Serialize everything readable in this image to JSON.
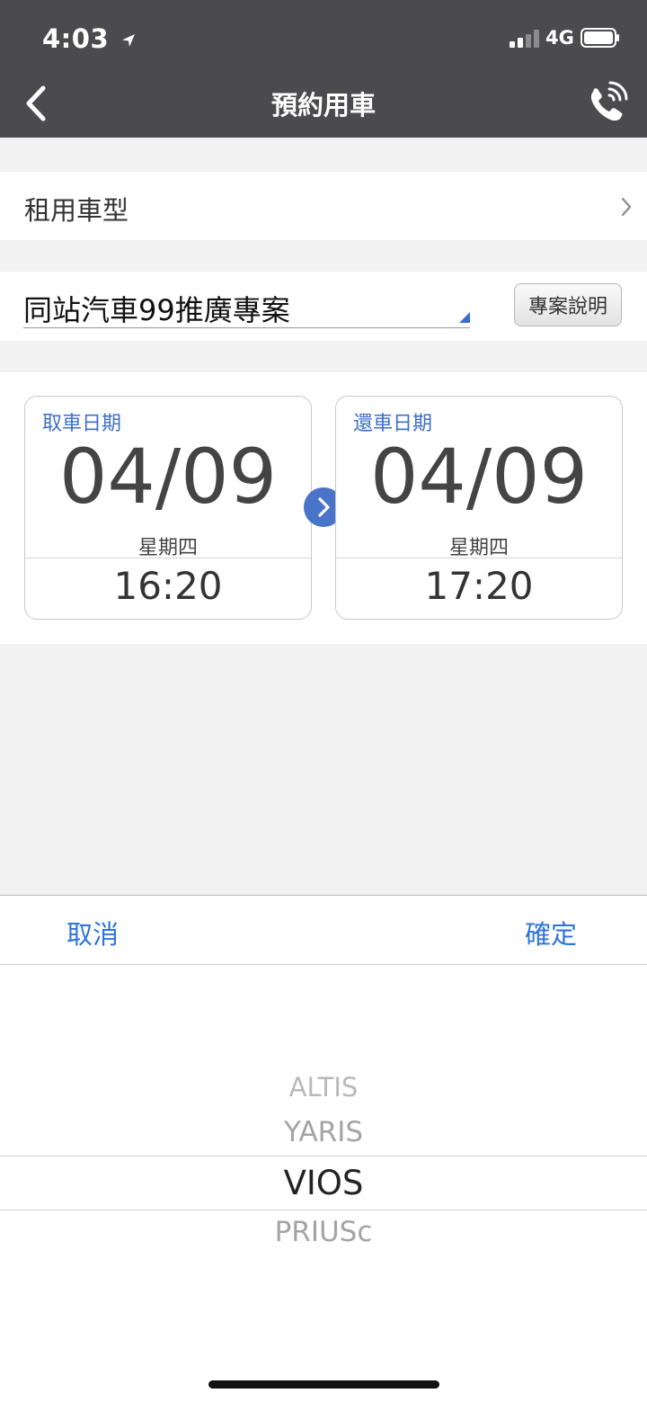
{
  "status_bar": {
    "time": "4:03",
    "network": "4G"
  },
  "nav": {
    "title": "預約用車",
    "back_icon": "chevron-left-icon",
    "phone_icon": "phone-icon"
  },
  "car_type": {
    "label": "租用車型"
  },
  "plan": {
    "selected": "同站汽車99推廣專案",
    "info_button": "專案說明"
  },
  "pickup": {
    "label": "取車日期",
    "date": "04/09",
    "weekday": "星期四",
    "time": "16:20"
  },
  "return": {
    "label": "還車日期",
    "date": "04/09",
    "weekday": "星期四",
    "time": "17:20"
  },
  "picker": {
    "cancel": "取消",
    "confirm": "確定",
    "options": [
      "ALTIS",
      "YARIS",
      "VIOS",
      "PRIUSc"
    ],
    "selected": "VIOS"
  },
  "colors": {
    "nav_bg": "#4b4b4d",
    "accent_blue": "#2f74d9",
    "card_label_blue": "#3d6fca"
  }
}
